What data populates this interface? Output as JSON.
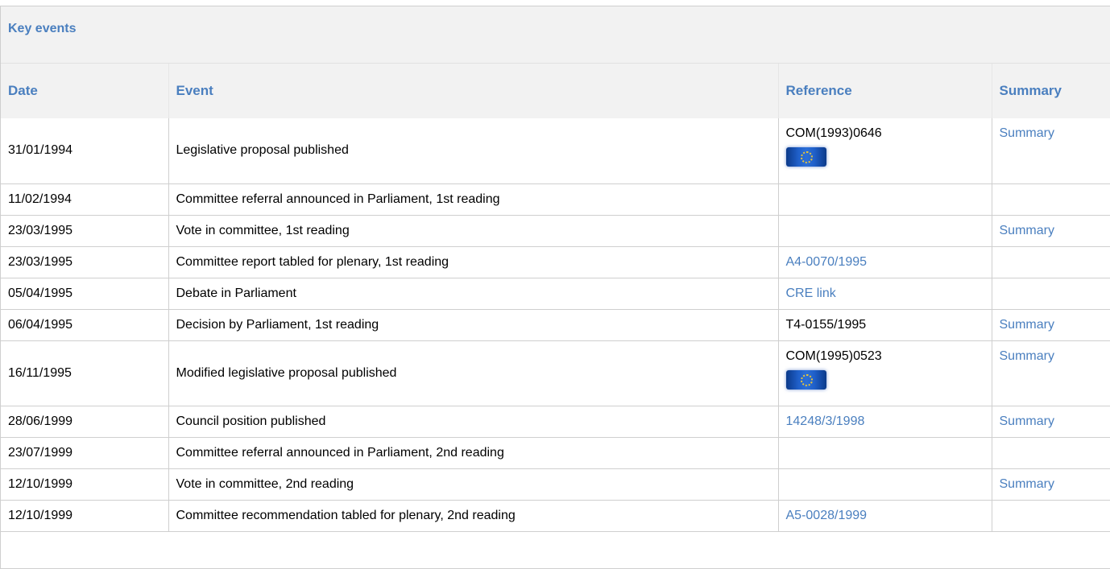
{
  "panel": {
    "title": "Key events"
  },
  "columns": {
    "date": "Date",
    "event": "Event",
    "reference": "Reference",
    "summary": "Summary"
  },
  "rows": [
    {
      "date": "31/01/1994",
      "event": "Legislative proposal published",
      "reference": "COM(1993)0646",
      "summary": "Summary"
    },
    {
      "date": "11/02/1994",
      "event": "Committee referral announced in Parliament, 1st reading",
      "reference": "",
      "summary": ""
    },
    {
      "date": "23/03/1995",
      "event": "Vote in committee, 1st reading",
      "reference": "",
      "summary": "Summary"
    },
    {
      "date": "23/03/1995",
      "event": "Committee report tabled for plenary, 1st reading",
      "reference": "A4-0070/1995",
      "summary": ""
    },
    {
      "date": "05/04/1995",
      "event": "Debate in Parliament",
      "reference": "CRE link",
      "summary": ""
    },
    {
      "date": "06/04/1995",
      "event": "Decision by Parliament, 1st reading",
      "reference": "T4-0155/1995",
      "summary": "Summary"
    },
    {
      "date": "16/11/1995",
      "event": "Modified legislative proposal published",
      "reference": "COM(1995)0523",
      "summary": "Summary"
    },
    {
      "date": "28/06/1999",
      "event": "Council position published",
      "reference": "14248/3/1998",
      "summary": "Summary"
    },
    {
      "date": "23/07/1999",
      "event": "Committee referral announced in Parliament, 2nd reading",
      "reference": "",
      "summary": ""
    },
    {
      "date": "12/10/1999",
      "event": "Vote in committee, 2nd reading",
      "reference": "",
      "summary": "Summary"
    },
    {
      "date": "12/10/1999",
      "event": "Committee recommendation tabled for plenary, 2nd reading",
      "reference": "A5-0028/1999",
      "summary": ""
    }
  ]
}
